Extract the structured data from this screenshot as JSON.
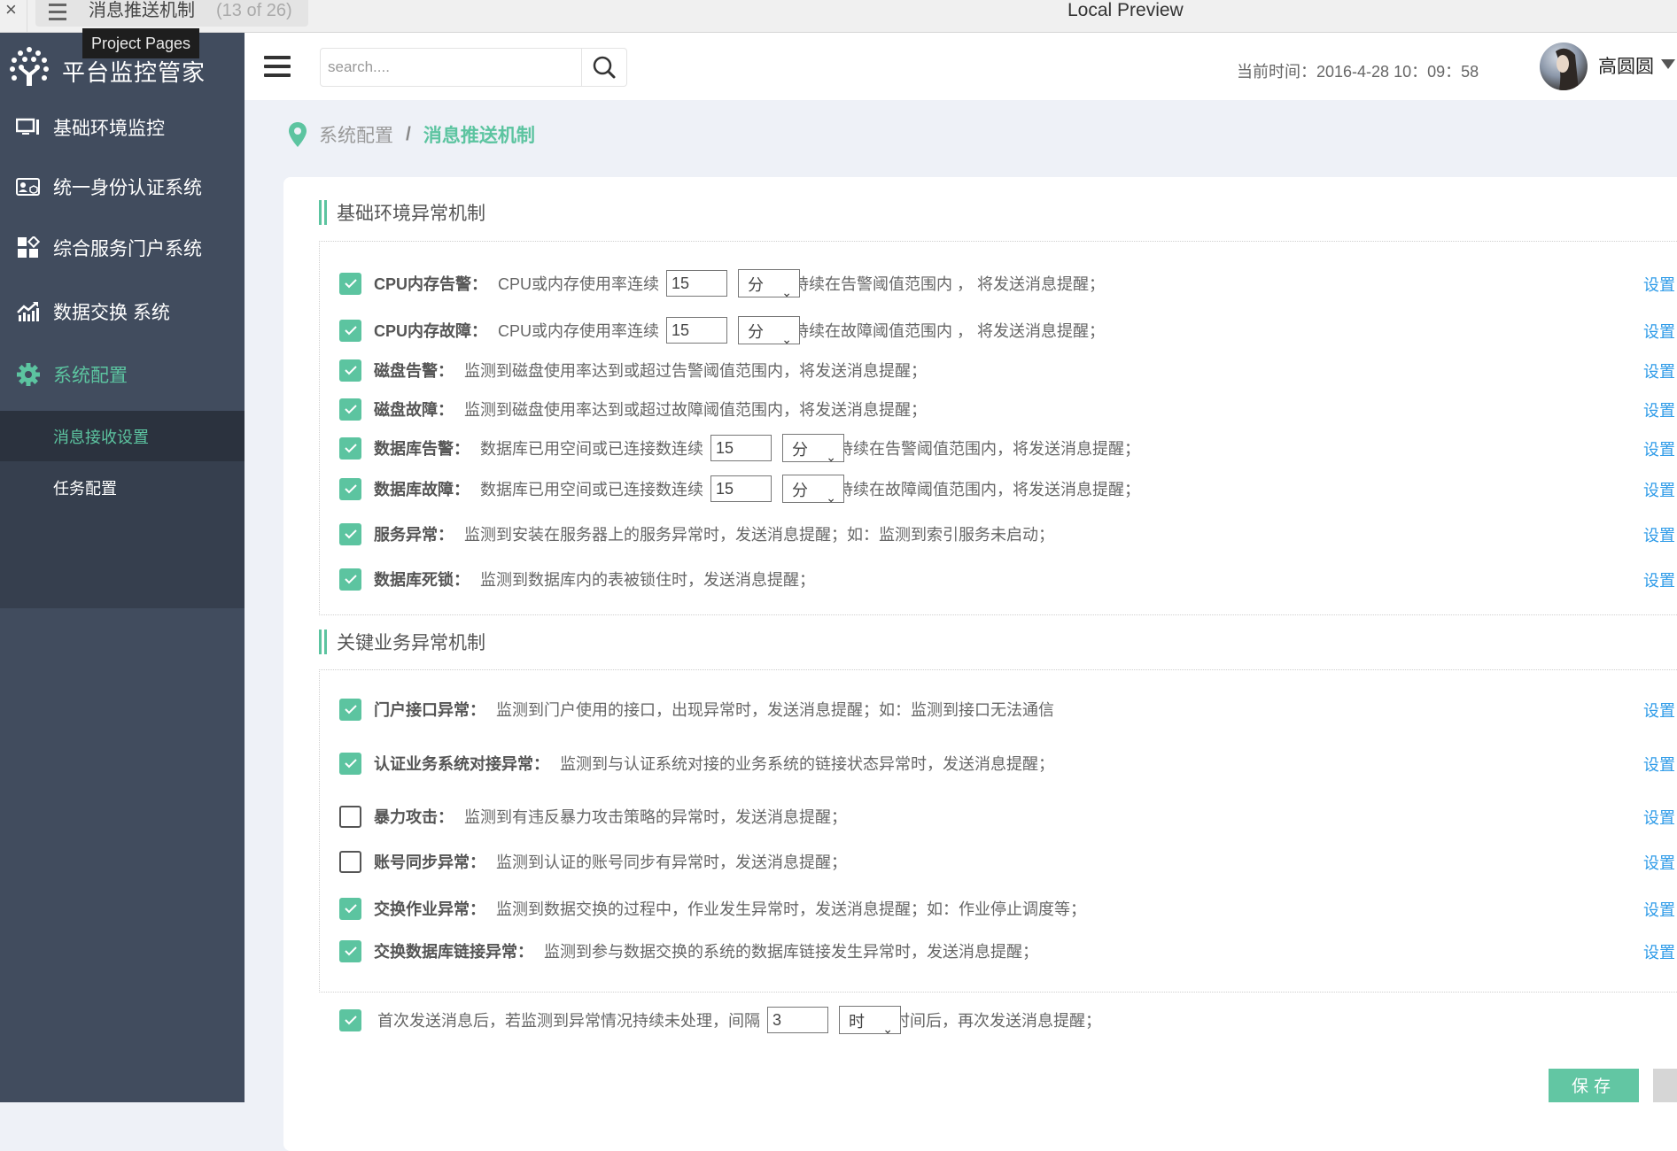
{
  "preview_bar": {
    "close_glyph": "×",
    "page_title": "消息推送机制",
    "page_count": "(13 of 26)",
    "window_title": "Local Preview",
    "tooltip": "Project Pages"
  },
  "app": {
    "name": "平台监控管家",
    "accent_color": "#5cc4a0",
    "link_color": "#2e9be8"
  },
  "sidebar": {
    "items": [
      {
        "label": "基础环境监控",
        "icon": "monitor-icon"
      },
      {
        "label": "统一身份认证系统",
        "icon": "id-card-icon"
      },
      {
        "label": "综合服务门户系统",
        "icon": "grid-icon"
      },
      {
        "label": "数据交换 系统",
        "icon": "chart-icon"
      },
      {
        "label": "系统配置",
        "icon": "gear-icon",
        "active": true
      }
    ],
    "subitems": [
      {
        "label": "消息接收设置",
        "active": true
      },
      {
        "label": "任务配置"
      }
    ]
  },
  "header": {
    "search_placeholder": "search....",
    "time_label": "当前时间：2016-4-28    10：09：58",
    "user_name": "高圆圆"
  },
  "breadcrumb": {
    "parent": "系统配置",
    "separator": "/",
    "current": "消息推送机制"
  },
  "sections": [
    {
      "title": "基础环境异常机制",
      "rows": [
        {
          "checked": true,
          "name": "CPU内存告警：",
          "pre": "CPU或内存使用率连续",
          "value": "15",
          "unit": "分",
          "post": "持续在告警阈值范围内 ， 将发送消息提醒；",
          "link": "设置"
        },
        {
          "checked": true,
          "name": "CPU内存故障：",
          "pre": "CPU或内存使用率连续",
          "value": "15",
          "unit": "分",
          "post": "持续在故障阈值范围内 ， 将发送消息提醒；",
          "link": "设置"
        },
        {
          "checked": true,
          "name": "磁盘告警：",
          "desc": "监测到磁盘使用率达到或超过告警阈值范围内，将发送消息提醒；",
          "link": "设置"
        },
        {
          "checked": true,
          "name": "磁盘故障：",
          "desc": "监测到磁盘使用率达到或超过故障阈值范围内，将发送消息提醒；",
          "link": "设置"
        },
        {
          "checked": true,
          "name": "数据库告警：",
          "pre": "数据库已用空间或已连接数连续",
          "value": "15",
          "unit": "分",
          "post": "持续在告警阈值范围内，将发送消息提醒；",
          "link": "设置"
        },
        {
          "checked": true,
          "name": "数据库故障：",
          "pre": "数据库已用空间或已连接数连续",
          "value": "15",
          "unit": "分",
          "post": "持续在故障阈值范围内，将发送消息提醒；",
          "link": "设置"
        },
        {
          "checked": true,
          "name": "服务异常：",
          "desc": "监测到安装在服务器上的服务异常时，发送消息提醒；如：监测到索引服务未启动；",
          "link": "设置"
        },
        {
          "checked": true,
          "name": "数据库死锁：",
          "desc": "监测到数据库内的表被锁住时，发送消息提醒；",
          "link": "设置"
        }
      ]
    },
    {
      "title": "关键业务异常机制",
      "rows": [
        {
          "checked": true,
          "name": "门户接口异常：",
          "desc": "监测到门户使用的接口，出现异常时，发送消息提醒；如：监测到接口无法通信",
          "link": "设置"
        },
        {
          "checked": true,
          "name": "认证业务系统对接异常：",
          "desc": "监测到与认证系统对接的业务系统的链接状态异常时，发送消息提醒；",
          "link": "设置"
        },
        {
          "checked": false,
          "name": "暴力攻击：",
          "desc": "监测到有违反暴力攻击策略的异常时，发送消息提醒；",
          "link": "设置"
        },
        {
          "checked": false,
          "name": "账号同步异常：",
          "desc": "监测到认证的账号同步有异常时，发送消息提醒；",
          "link": "设置"
        },
        {
          "checked": true,
          "name": "交换作业异常：",
          "desc": "监测到数据交换的过程中，作业发生异常时，发送消息提醒；如：作业停止调度等；",
          "link": "设置"
        },
        {
          "checked": true,
          "name": "交换数据库链接异常：",
          "desc": "监测到参与数据交换的系统的数据库链接发生异常时，发送消息提醒；",
          "link": "设置"
        }
      ]
    }
  ],
  "repeat_rule": {
    "checked": true,
    "pre": "首次发送消息后，若监测到异常情况持续未处理，间隔",
    "value": "3",
    "unit": "时",
    "post": "时间后，再次发送消息提醒；"
  },
  "actions": {
    "save_label": "保存",
    "cancel_label": ""
  }
}
